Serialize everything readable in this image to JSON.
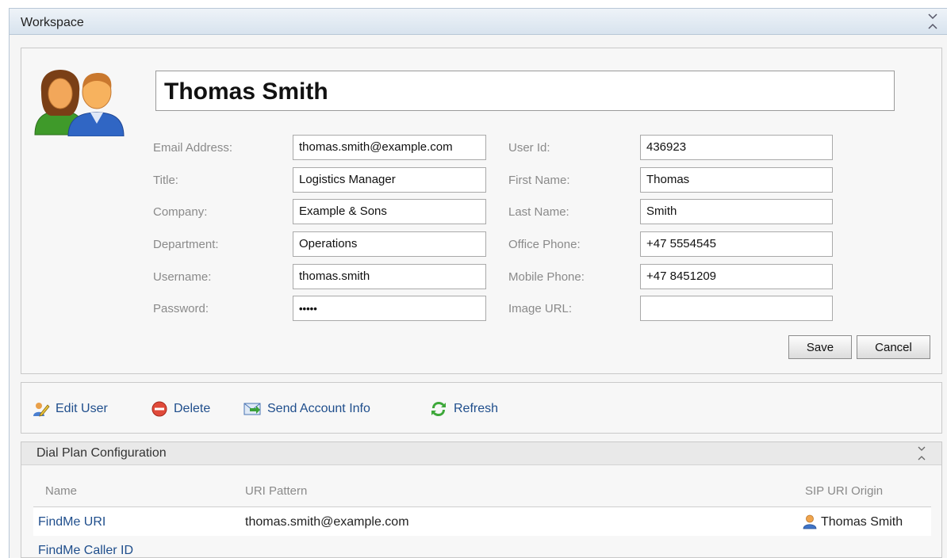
{
  "workspace": {
    "title": "Workspace"
  },
  "user": {
    "display_name": "Thomas Smith",
    "fields_left": [
      {
        "label": "Email Address:",
        "value": "thomas.smith@example.com"
      },
      {
        "label": "Title:",
        "value": "Logistics Manager"
      },
      {
        "label": "Company:",
        "value": "Example & Sons"
      },
      {
        "label": "Department:",
        "value": "Operations"
      },
      {
        "label": "Username:",
        "value": "thomas.smith"
      },
      {
        "label": "Password:",
        "value": "•••••"
      }
    ],
    "fields_right": [
      {
        "label": "User Id:",
        "value": "436923"
      },
      {
        "label": "First Name:",
        "value": "Thomas"
      },
      {
        "label": "Last Name:",
        "value": "Smith"
      },
      {
        "label": "Office Phone:",
        "value": "+47 5554545"
      },
      {
        "label": "Mobile Phone:",
        "value": "+47 8451209"
      },
      {
        "label": "Image URL:",
        "value": ""
      }
    ],
    "save_label": "Save",
    "cancel_label": "Cancel"
  },
  "actions": [
    {
      "label": "Edit User",
      "icon": "edit-user-icon"
    },
    {
      "label": "Delete",
      "icon": "delete-icon"
    },
    {
      "label": "Send Account Info",
      "icon": "send-mail-icon"
    },
    {
      "label": "Refresh",
      "icon": "refresh-icon"
    }
  ],
  "dial_plan": {
    "title": "Dial Plan Configuration",
    "columns": [
      "Name",
      "URI Pattern",
      "SIP URI Origin"
    ],
    "rows": [
      {
        "name": "FindMe URI",
        "uri_pattern": "thomas.smith@example.com",
        "origin": "Thomas Smith"
      },
      {
        "name": "FindMe Caller ID",
        "uri_pattern": "",
        "origin": ""
      }
    ]
  },
  "colors": {
    "link": "#1f4e8c",
    "label": "#8a8a8a",
    "header_bg": "#d8e3ee"
  }
}
